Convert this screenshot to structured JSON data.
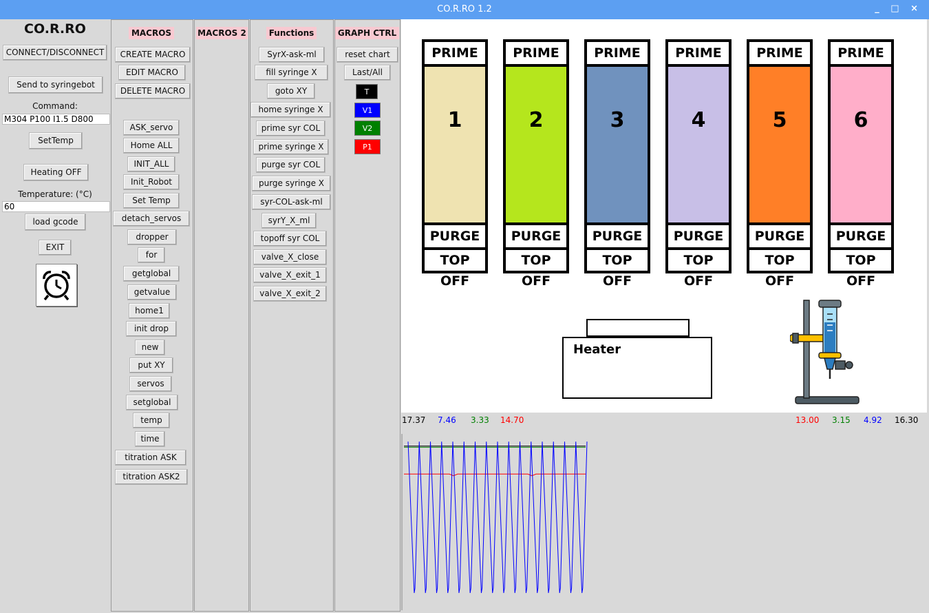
{
  "window": {
    "title": "CO.R.RO 1.2",
    "controls": [
      "_",
      "□",
      "×"
    ]
  },
  "left": {
    "app_name": "CO.R.RO",
    "connect_label": "CONNECT/DISCONNECT",
    "send_label": "Send to syringebot",
    "command_label": "Command:",
    "command_value": "M304 P100 I1.5 D800",
    "settemp_label": "SetTemp",
    "heating_label": "Heating OFF",
    "temperature_label": "Temperature: (°C)",
    "temperature_value": "60",
    "load_label": "load gcode",
    "exit_label": "EXIT"
  },
  "macros": {
    "header": "MACROS",
    "create": "CREATE MACRO",
    "edit": "EDIT MACRO",
    "delete": "DELETE MACRO",
    "items": [
      "ASK_servo",
      "Home ALL",
      "INIT_ALL",
      "Init_Robot",
      "Set Temp",
      "detach_servos",
      "dropper",
      "for",
      "getglobal",
      "getvalue",
      "home1",
      "init drop",
      "new",
      "put XY",
      "servos",
      "setglobal",
      "temp",
      "time",
      "titration ASK",
      "titration ASK2"
    ]
  },
  "macros2": {
    "header": "MACROS 2"
  },
  "functions": {
    "header": "Functions",
    "items": [
      "SyrX-ask-ml",
      "fill syringe X",
      "goto XY",
      "home syringe X",
      "prime syr COL",
      "prime syringe X",
      "purge syr COL",
      "purge syringe X",
      "syr-COL-ask-ml",
      "syrY_X_ml",
      "topoff syr COL",
      "valve_X_close",
      "valve_X_exit_1",
      "valve_X_exit_2"
    ]
  },
  "graph_ctrl": {
    "header": "GRAPH CTRL",
    "reset": "reset chart",
    "lastall": "Last/All",
    "swatches": [
      {
        "label": "T",
        "color": "#000000"
      },
      {
        "label": "V1",
        "color": "#0000ff"
      },
      {
        "label": "V2",
        "color": "#008000"
      },
      {
        "label": "P1",
        "color": "#ff0000"
      }
    ]
  },
  "channels": [
    {
      "prime": "PRIME",
      "number": "1",
      "color": "#efe3b1",
      "purge": "PURGE",
      "topoff": "TOP OFF"
    },
    {
      "prime": "PRIME",
      "number": "2",
      "color": "#b5e61d",
      "purge": "PURGE",
      "topoff": "TOP OFF"
    },
    {
      "prime": "PRIME",
      "number": "3",
      "color": "#7092be",
      "purge": "PURGE",
      "topoff": "TOP OFF"
    },
    {
      "prime": "PRIME",
      "number": "4",
      "color": "#c8bfe7",
      "purge": "PURGE",
      "topoff": "TOP OFF"
    },
    {
      "prime": "PRIME",
      "number": "5",
      "color": "#ff7f27",
      "purge": "PURGE",
      "topoff": "TOP OFF"
    },
    {
      "prime": "PRIME",
      "number": "6",
      "color": "#ffaec9",
      "purge": "PURGE",
      "topoff": "TOP OFF"
    }
  ],
  "heater": {
    "label": "Heater"
  },
  "readouts": {
    "left": [
      {
        "value": "17.37",
        "color": "#000000"
      },
      {
        "value": "7.46",
        "color": "#0000ff"
      },
      {
        "value": "3.33",
        "color": "#008000"
      },
      {
        "value": "14.70",
        "color": "#ff0000"
      }
    ],
    "right": [
      {
        "value": "13.00",
        "color": "#ff0000"
      },
      {
        "value": "3.15",
        "color": "#008000"
      },
      {
        "value": "4.92",
        "color": "#0000ff"
      },
      {
        "value": "16.30",
        "color": "#000000"
      }
    ]
  },
  "chart_data": {
    "type": "line",
    "series": [
      {
        "color": "#0000ff",
        "cycles": 16,
        "min": 4.92,
        "max": 17.37
      },
      {
        "color": "#ff0000",
        "level": 14.7
      },
      {
        "color": "#008000",
        "level": 16.9
      },
      {
        "color": "#000000",
        "level": 17.0
      }
    ],
    "ylim": [
      3.5,
      18
    ]
  }
}
